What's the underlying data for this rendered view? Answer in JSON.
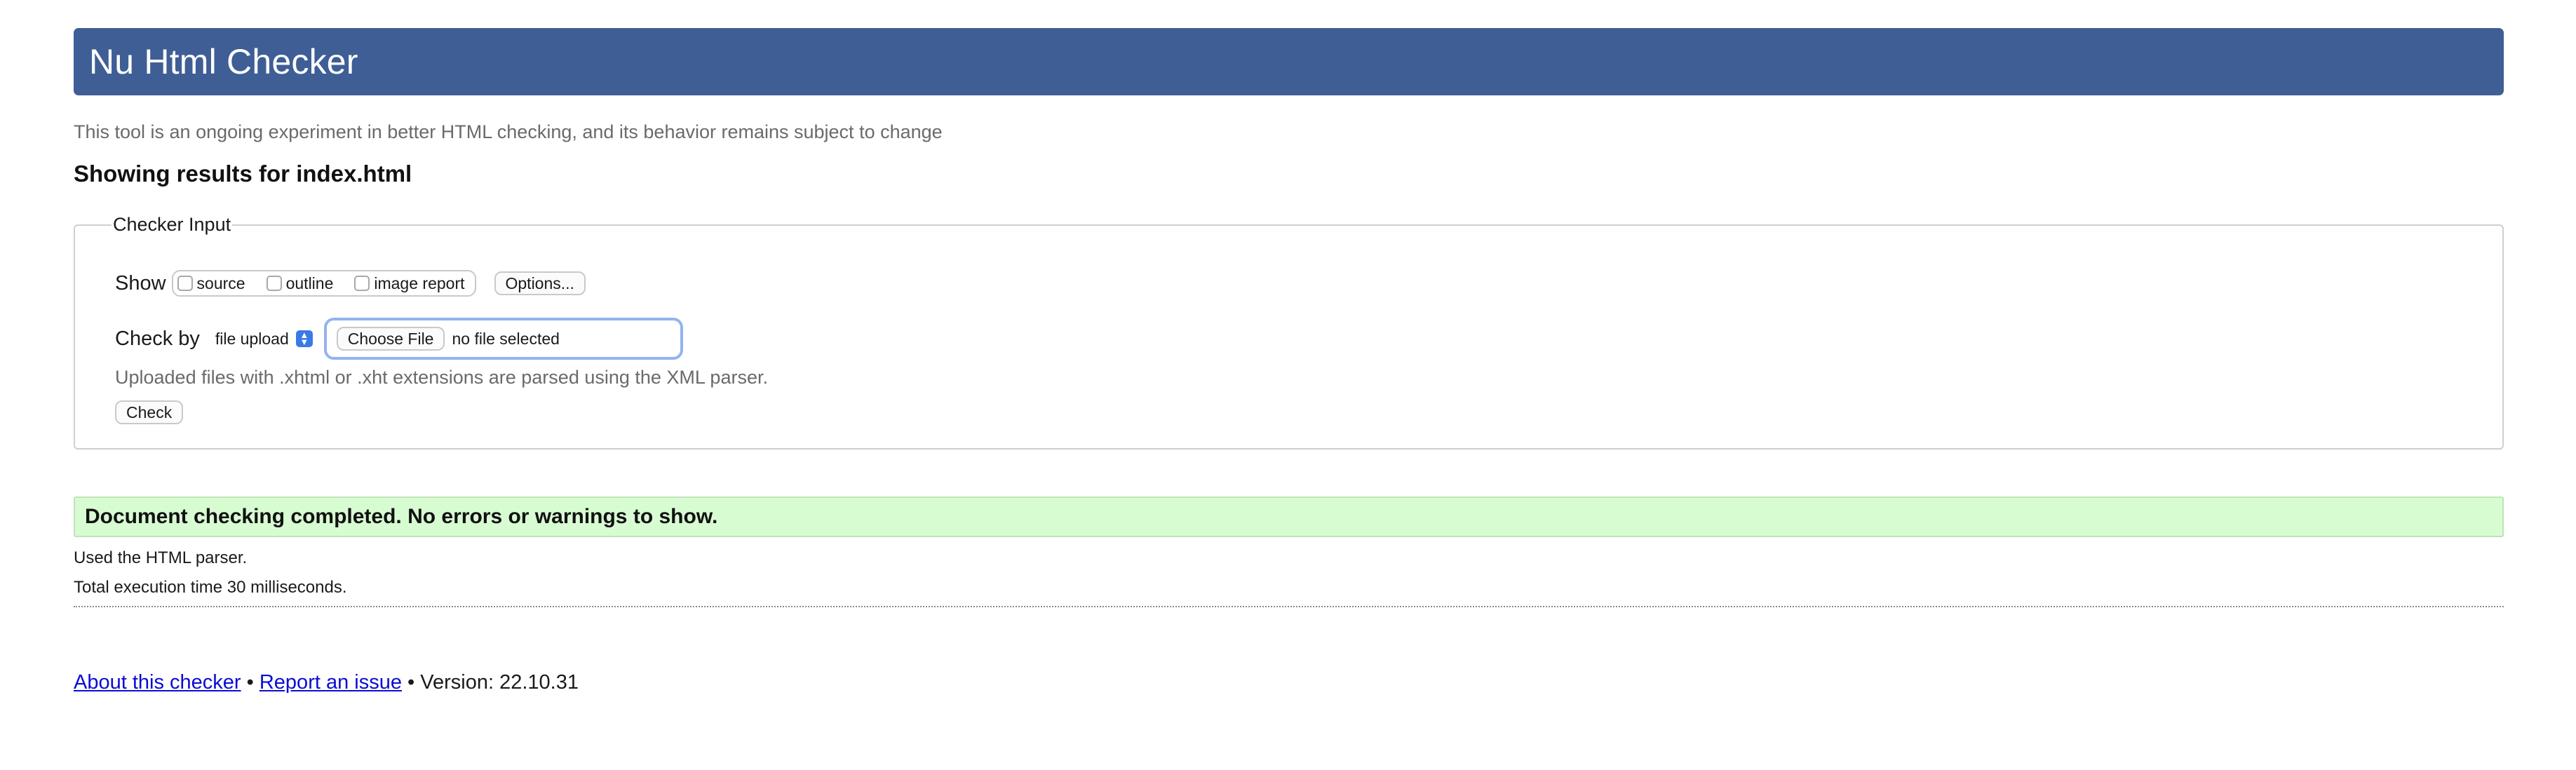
{
  "header": {
    "title": "Nu Html Checker"
  },
  "notice": "This tool is an ongoing experiment in better HTML checking, and its behavior remains subject to change",
  "results_heading": "Showing results for index.html",
  "checker_input": {
    "legend": "Checker Input",
    "show_label": "Show",
    "show_options": [
      {
        "label": "source",
        "checked": false
      },
      {
        "label": "outline",
        "checked": false
      },
      {
        "label": "image report",
        "checked": false
      }
    ],
    "options_button": "Options...",
    "check_by_label": "Check by",
    "check_by_value": "file upload",
    "choose_file_button": "Choose File",
    "file_status": "no file selected",
    "hint": "Uploaded files with .xhtml or .xht extensions are parsed using the XML parser.",
    "check_button": "Check"
  },
  "result": {
    "success_message": "Document checking completed. No errors or warnings to show.",
    "parser_info": "Used the HTML parser.",
    "execution_time": "Total execution time 30 milliseconds."
  },
  "footer": {
    "about_link": "About this checker",
    "separator": "•",
    "report_link": "Report an issue",
    "version_text": "Version: 22.10.31"
  },
  "colors": {
    "header_bg": "#3f5e96",
    "success_bg": "#d8fcd2",
    "link": "#0b0bd6",
    "focus_ring": "#93b4ee"
  }
}
